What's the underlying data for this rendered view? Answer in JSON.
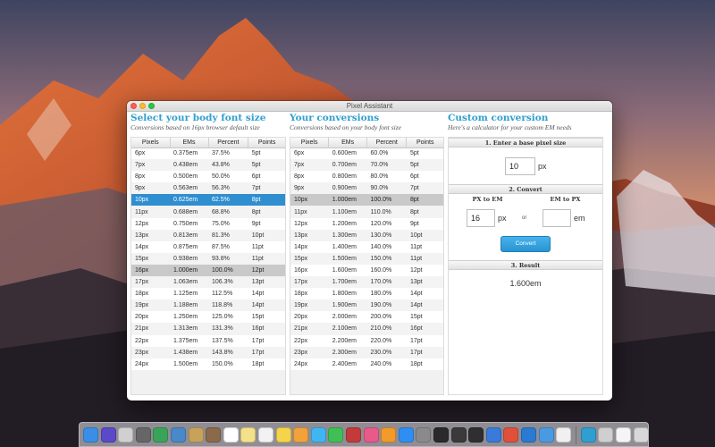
{
  "colors": {
    "accent": "#2f9fd0",
    "selected_row": "#2f8ed0",
    "button": "#2a94d2"
  },
  "window": {
    "title": "Pixel Assistant"
  },
  "select_panel": {
    "heading": "Select your body font size",
    "subheading": "Conversions based on 16px browser default size",
    "columns": [
      "Pixels",
      "EMs",
      "Percent",
      "Points"
    ],
    "rows": [
      [
        "6px",
        "0.375em",
        "37.5%",
        "5pt"
      ],
      [
        "7px",
        "0.438em",
        "43.8%",
        "5pt"
      ],
      [
        "8px",
        "0.500em",
        "50.0%",
        "6pt"
      ],
      [
        "9px",
        "0.563em",
        "56.3%",
        "7pt"
      ],
      [
        "10px",
        "0.625em",
        "62.5%",
        "8pt"
      ],
      [
        "11px",
        "0.688em",
        "68.8%",
        "8pt"
      ],
      [
        "12px",
        "0.750em",
        "75.0%",
        "9pt"
      ],
      [
        "13px",
        "0.813em",
        "81.3%",
        "10pt"
      ],
      [
        "14px",
        "0.875em",
        "87.5%",
        "11pt"
      ],
      [
        "15px",
        "0.938em",
        "93.8%",
        "11pt"
      ],
      [
        "16px",
        "1.000em",
        "100.0%",
        "12pt"
      ],
      [
        "17px",
        "1.063em",
        "106.3%",
        "13pt"
      ],
      [
        "18px",
        "1.125em",
        "112.5%",
        "14pt"
      ],
      [
        "19px",
        "1.188em",
        "118.8%",
        "14pt"
      ],
      [
        "20px",
        "1.250em",
        "125.0%",
        "15pt"
      ],
      [
        "21px",
        "1.313em",
        "131.3%",
        "16pt"
      ],
      [
        "22px",
        "1.375em",
        "137.5%",
        "17pt"
      ],
      [
        "23px",
        "1.438em",
        "143.8%",
        "17pt"
      ],
      [
        "24px",
        "1.500em",
        "150.0%",
        "18pt"
      ]
    ],
    "selected_index": 4,
    "default_index": 10
  },
  "conversions_panel": {
    "heading": "Your conversions",
    "subheading": "Conversions based on your body font size",
    "columns": [
      "Pixels",
      "EMs",
      "Percent",
      "Points"
    ],
    "rows": [
      [
        "6px",
        "0.600em",
        "60.0%",
        "5pt"
      ],
      [
        "7px",
        "0.700em",
        "70.0%",
        "5pt"
      ],
      [
        "8px",
        "0.800em",
        "80.0%",
        "6pt"
      ],
      [
        "9px",
        "0.900em",
        "90.0%",
        "7pt"
      ],
      [
        "10px",
        "1.000em",
        "100.0%",
        "8pt"
      ],
      [
        "11px",
        "1.100em",
        "110.0%",
        "8pt"
      ],
      [
        "12px",
        "1.200em",
        "120.0%",
        "9pt"
      ],
      [
        "13px",
        "1.300em",
        "130.0%",
        "10pt"
      ],
      [
        "14px",
        "1.400em",
        "140.0%",
        "11pt"
      ],
      [
        "15px",
        "1.500em",
        "150.0%",
        "11pt"
      ],
      [
        "16px",
        "1.600em",
        "160.0%",
        "12pt"
      ],
      [
        "17px",
        "1.700em",
        "170.0%",
        "13pt"
      ],
      [
        "18px",
        "1.800em",
        "180.0%",
        "14pt"
      ],
      [
        "19px",
        "1.900em",
        "190.0%",
        "14pt"
      ],
      [
        "20px",
        "2.000em",
        "200.0%",
        "15pt"
      ],
      [
        "21px",
        "2.100em",
        "210.0%",
        "16pt"
      ],
      [
        "22px",
        "2.200em",
        "220.0%",
        "17pt"
      ],
      [
        "23px",
        "2.300em",
        "230.0%",
        "17pt"
      ],
      [
        "24px",
        "2.400em",
        "240.0%",
        "18pt"
      ]
    ],
    "highlight_index": 4
  },
  "custom_panel": {
    "heading": "Custom conversion",
    "subheading": "Here's a calculator for your custom EM needs",
    "step1_label": "1. Enter a base pixel size",
    "base_value": "10",
    "base_unit": "px",
    "step2_label": "2. Convert",
    "px_to_em_label": "PX to EM",
    "em_to_px_label": "EM to PX",
    "px_value": "16",
    "px_unit": "px",
    "or_label": "or",
    "em_value": "",
    "em_unit": "em",
    "convert_label": "Convert",
    "step3_label": "3. Result",
    "result_value": "1.600em"
  },
  "dock": {
    "icons": [
      {
        "name": "finder-icon",
        "color": "#3a8ee6"
      },
      {
        "name": "siri-icon",
        "color": "#5a4ac8"
      },
      {
        "name": "launchpad-icon",
        "color": "#d0d0d0"
      },
      {
        "name": "rocket-icon",
        "color": "#666666"
      },
      {
        "name": "app-store-grid-icon",
        "color": "#3aa35a"
      },
      {
        "name": "photos-viewer-icon",
        "color": "#4a88c7"
      },
      {
        "name": "mail-icon",
        "color": "#c7a25a"
      },
      {
        "name": "contacts-icon",
        "color": "#8a6a4a"
      },
      {
        "name": "calendar-icon",
        "color": "#ffffff"
      },
      {
        "name": "notes-icon",
        "color": "#f4e28a"
      },
      {
        "name": "reminders-icon",
        "color": "#f2f2f2"
      },
      {
        "name": "stickies-icon",
        "color": "#f6d44a"
      },
      {
        "name": "photos-icon",
        "color": "#f2a23a"
      },
      {
        "name": "messages-icon",
        "color": "#3fb6f2"
      },
      {
        "name": "facetime-icon",
        "color": "#3fbf55"
      },
      {
        "name": "photo-booth-icon",
        "color": "#c23a3a"
      },
      {
        "name": "music-icon",
        "color": "#e85a8a"
      },
      {
        "name": "books-icon",
        "color": "#f29a2a"
      },
      {
        "name": "app-store-icon",
        "color": "#2f8ef2"
      },
      {
        "name": "preferences-icon",
        "color": "#8a8a8a"
      },
      {
        "name": "terminal-icon",
        "color": "#2a2a2a"
      },
      {
        "name": "console-icon",
        "color": "#3a3a3a"
      },
      {
        "name": "activity-monitor-icon",
        "color": "#2f2f2f"
      },
      {
        "name": "safari-icon",
        "color": "#3a7ad8"
      },
      {
        "name": "chrome-icon",
        "color": "#e0503a"
      },
      {
        "name": "vscode-icon",
        "color": "#2a7ad2"
      },
      {
        "name": "xcode-icon",
        "color": "#4a9ae2"
      },
      {
        "name": "text-icon",
        "color": "#f0f0f0"
      },
      {
        "name": "pixel-assistant-icon",
        "color": "#2f9fd0"
      },
      {
        "name": "wifi-icon",
        "color": "#cfcfcf"
      },
      {
        "name": "document-icon",
        "color": "#f5f5f5"
      },
      {
        "name": "trash-icon",
        "color": "#d8d8d8"
      }
    ]
  }
}
